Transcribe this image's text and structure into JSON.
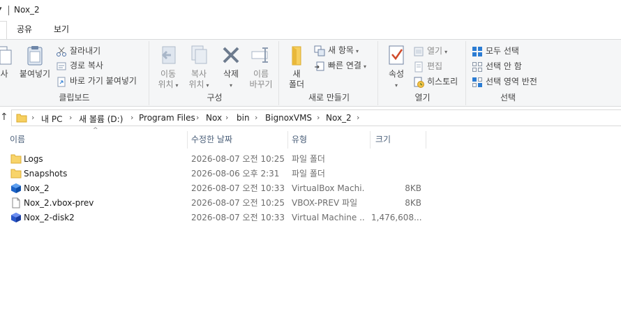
{
  "window": {
    "title": "Nox_2"
  },
  "ribbon_tabs": {
    "share": "공유",
    "view": "보기"
  },
  "clipboard": {
    "copy_partial": "사",
    "paste": "붙여넣기",
    "cut": "잘라내기",
    "copy_path": "경로 복사",
    "paste_shortcut": "바로 가기 붙여넣기",
    "label": "클립보드"
  },
  "organize": {
    "move_to_1": "이동",
    "move_to_2": "위치",
    "copy_to_1": "복사",
    "copy_to_2": "위치",
    "delete": "삭제",
    "rename_1": "이름",
    "rename_2": "바꾸기",
    "label": "구성"
  },
  "new": {
    "new_folder_1": "새",
    "new_folder_2": "폴더",
    "new_item": "새 항목",
    "easy_access": "빠른 연결",
    "label": "새로 만들기"
  },
  "open": {
    "properties": "속성",
    "open": "열기",
    "edit": "편집",
    "history": "히스토리",
    "label": "열기"
  },
  "select": {
    "select_all": "모두 선택",
    "select_none": "선택 안 함",
    "invert": "선택 영역 반전",
    "label": "선택"
  },
  "address": {
    "crumbs": [
      "내 PC",
      "새 볼륨 (D:)",
      "Program Files",
      "Nox",
      "bin",
      "BignoxVMS",
      "Nox_2"
    ]
  },
  "columns": {
    "name": "이름",
    "modified": "수정한 날짜",
    "type": "유형",
    "size": "크기"
  },
  "files": [
    {
      "name": "Logs",
      "modified": "2026-08-07 오전 10:25",
      "type": "파일 폴더",
      "size": "",
      "icon": "folder-icon"
    },
    {
      "name": "Snapshots",
      "modified": "2026-08-06 오후 2:31",
      "type": "파일 폴더",
      "size": "",
      "icon": "folder-icon"
    },
    {
      "name": "Nox_2",
      "modified": "2026-08-07 오전 10:33",
      "type": "VirtualBox Machi...",
      "size": "8KB",
      "icon": "virtualbox-icon"
    },
    {
      "name": "Nox_2.vbox-prev",
      "modified": "2026-08-07 오전 10:25",
      "type": "VBOX-PREV 파일",
      "size": "8KB",
      "icon": "file-icon"
    },
    {
      "name": "Nox_2-disk2",
      "modified": "2026-08-07 오전 10:33",
      "type": "Virtual Machine ...",
      "size": "1,476,608...",
      "icon": "disk-icon"
    }
  ],
  "colors": {
    "folder": "#f8d46a",
    "vbox_blue": "#1e64c8",
    "header_text": "#4c607a",
    "accent": "#2b7cd3"
  }
}
